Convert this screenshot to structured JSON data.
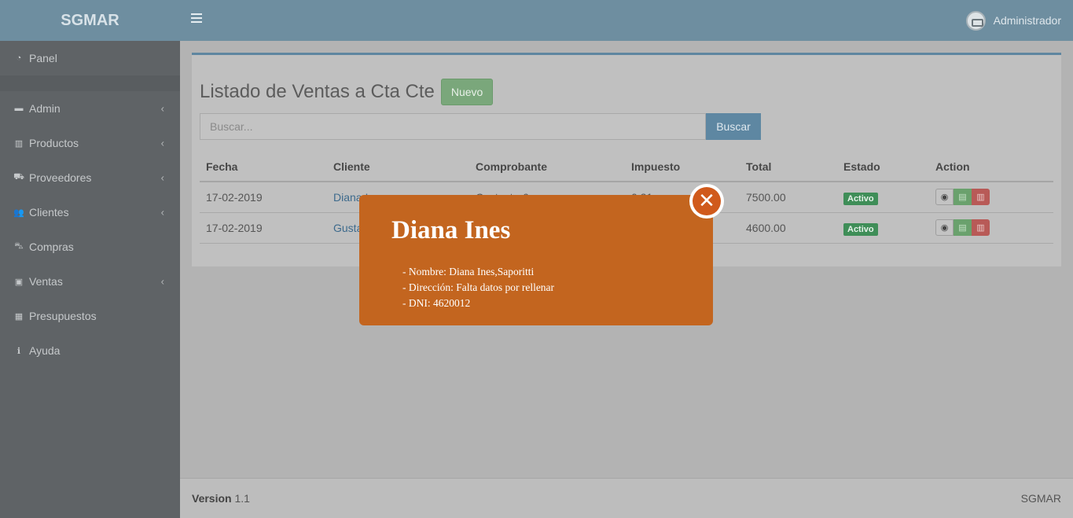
{
  "app": {
    "logo": "SGMAR"
  },
  "sidebar": {
    "items": [
      {
        "label": "Panel",
        "icon": "dashboard-icon",
        "glyph": "◔",
        "chevron": false
      },
      {
        "label": "Admin",
        "icon": "folder-icon",
        "glyph": "▬",
        "chevron": true
      },
      {
        "label": "Productos",
        "icon": "barcode-icon",
        "glyph": "▥",
        "chevron": true
      },
      {
        "label": "Proveedores",
        "icon": "truck-icon",
        "glyph": "⛟",
        "chevron": true
      },
      {
        "label": "Clientes",
        "icon": "users-icon",
        "glyph": "👥",
        "chevron": true
      },
      {
        "label": "Compras",
        "icon": "cart-icon",
        "glyph": "⛍",
        "chevron": false
      },
      {
        "label": "Ventas",
        "icon": "money-icon",
        "glyph": "▣",
        "chevron": true
      },
      {
        "label": "Presupuestos",
        "icon": "calculator-icon",
        "glyph": "▦",
        "chevron": false
      },
      {
        "label": "Ayuda",
        "icon": "info-icon",
        "glyph": "ℹ",
        "chevron": false
      }
    ]
  },
  "header": {
    "user": "Administrador"
  },
  "main": {
    "title": "Listado de Ventas a Cta Cte",
    "new_label": "Nuevo",
    "search_placeholder": "Buscar...",
    "search_label": "Buscar",
    "columns": [
      "Fecha",
      "Cliente",
      "Comprobante",
      "Impuesto",
      "Total",
      "Estado",
      "Action"
    ],
    "rows": [
      {
        "fecha": "17-02-2019",
        "cliente": "Diana Ines",
        "comprobante": "C: ctacte-6",
        "impuesto": "0.21",
        "total": "7500.00",
        "estado": "Activo"
      },
      {
        "fecha": "17-02-2019",
        "cliente": "Gusta",
        "comprobante": "",
        "impuesto": "",
        "total": "4600.00",
        "estado": "Activo"
      }
    ]
  },
  "footer": {
    "version_label": "Version",
    "version": "1.1",
    "brand": "SGMAR"
  },
  "modal": {
    "title": "Diana Ines",
    "lines": [
      "- Nombre: Diana Ines,Saporitti",
      "- Dirección: Falta datos por rellenar",
      "- DNI: 4620012"
    ]
  },
  "colors": {
    "accent": "#6e8ea0",
    "modal": "#c3651f",
    "success": "#3f8e58",
    "danger": "#b85a57"
  }
}
